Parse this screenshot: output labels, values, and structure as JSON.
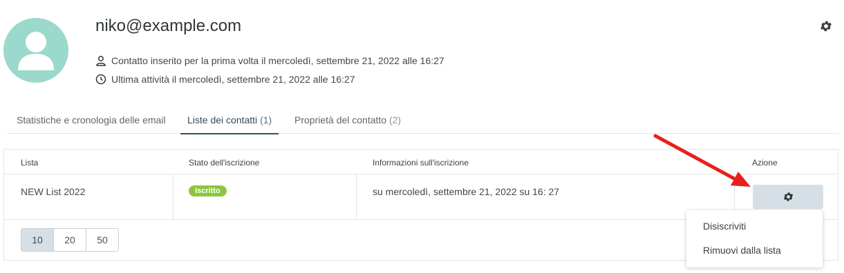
{
  "contact": {
    "email": "niko@example.com",
    "first_added": "Contatto inserito per la prima volta il mercoledì, settembre 21, 2022 alle 16:27",
    "last_activity": "Ultima attività il mercoledì, settembre 21, 2022 alle 16:27"
  },
  "tabs": [
    {
      "label": "Statistiche e cronologia delle email",
      "count": ""
    },
    {
      "label": "Liste dei contatti",
      "count": "(1)"
    },
    {
      "label": "Proprietà del contatto",
      "count": "(2)"
    }
  ],
  "table": {
    "headers": [
      "Lista",
      "Stato dell'iscrizione",
      "Informazioni sull'iscrizione",
      "Azione"
    ],
    "rows": [
      {
        "list": "NEW List 2022",
        "status": "Iscritto",
        "info": "su mercoledì, settembre 21, 2022 su 16: 27"
      }
    ]
  },
  "pagination": {
    "options": [
      "10",
      "20",
      "50"
    ],
    "selected": "10"
  },
  "action_menu": {
    "items": [
      "Disiscriviti",
      "Rimuovi dalla lista"
    ]
  },
  "colors": {
    "accent": "#2e5064",
    "badge": "#8cc63f",
    "avatar": "#9ad9cc",
    "annotation_arrow": "#e8201c"
  },
  "icons": [
    "user-avatar-icon",
    "gear-icon",
    "person-icon",
    "clock-icon",
    "red-arrow-annotation"
  ]
}
